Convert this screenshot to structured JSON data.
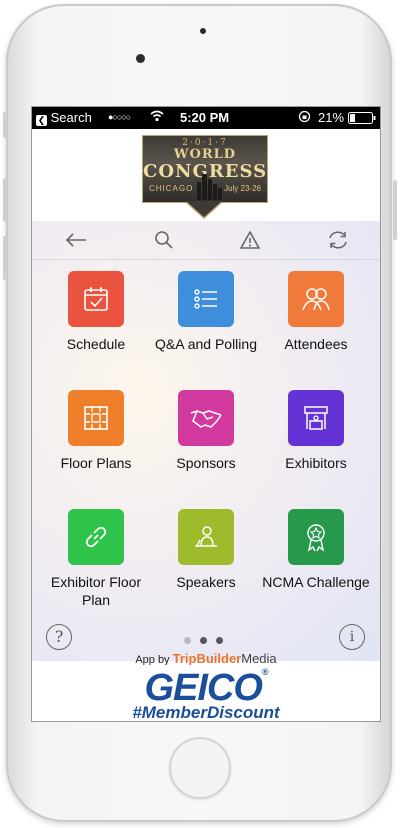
{
  "status_bar": {
    "back_label": "Search",
    "carrier_dots": "●○○○○",
    "time": "5:20 PM",
    "battery": "21%"
  },
  "logo": {
    "year": "2·0·1·7",
    "line1": "WORLD",
    "line2": "CONGRESS",
    "city": "CHICAGO",
    "dates": "July 23-26"
  },
  "toolbar": {
    "back_icon": "arrow-left-icon",
    "search_icon": "search-icon",
    "alert_icon": "warning-icon",
    "refresh_icon": "refresh-icon"
  },
  "tiles": [
    {
      "label": "Schedule",
      "color": "#e9533f",
      "icon": "calendar-icon"
    },
    {
      "label": "Q&A and Polling",
      "color": "#3f8ede",
      "icon": "list-icon"
    },
    {
      "label": "Attendees",
      "color": "#ef7a3a",
      "icon": "people-icon"
    },
    {
      "label": "Floor Plans",
      "color": "#ef7f2a",
      "icon": "floor-plan-icon"
    },
    {
      "label": "Sponsors",
      "color": "#d1399e",
      "icon": "handshake-icon"
    },
    {
      "label": "Exhibitors",
      "color": "#6433d6",
      "icon": "booth-icon"
    },
    {
      "label": "Exhibitor Floor Plan",
      "color": "#2fc449",
      "icon": "link-icon"
    },
    {
      "label": "Speakers",
      "color": "#9dbb2a",
      "icon": "speaker-icon"
    },
    {
      "label": "NCMA Challenge",
      "color": "#27994b",
      "icon": "award-icon"
    }
  ],
  "pager": {
    "count": 3,
    "active": 2
  },
  "credit": {
    "prefix": "App by ",
    "brand": "TripBuilder",
    "suffix": "Media"
  },
  "ad": {
    "brand": "GEICO",
    "reg": "®",
    "hashtag": "#MemberDiscount"
  }
}
